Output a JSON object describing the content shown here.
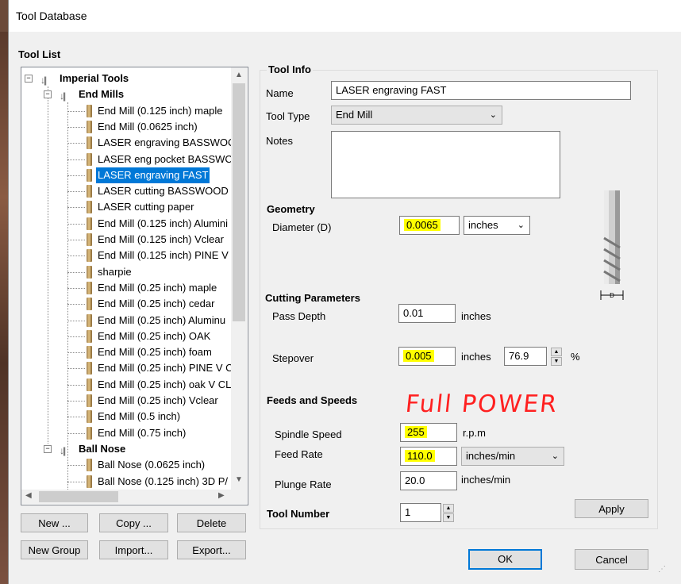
{
  "window": {
    "title": "Tool Database"
  },
  "tool_list": {
    "heading": "Tool List",
    "root": "Imperial Tools",
    "groups": [
      {
        "name": "End Mills",
        "items": [
          "End Mill (0.125 inch) maple",
          "End Mill (0.0625 inch)",
          "LASER engraving BASSWOC",
          "LASER eng pocket BASSWC",
          "LASER engraving FAST",
          "LASER cutting BASSWOOD",
          "LASER cutting paper",
          "End Mill (0.125 inch) Alumini",
          "End Mill (0.125 inch) Vclear",
          "End Mill (0.125 inch) PINE V",
          "sharpie",
          "End Mill (0.25 inch) maple",
          "End Mill (0.25 inch) cedar",
          "End Mill (0.25 inch) Aluminu",
          "End Mill (0.25 inch) OAK",
          "End Mill (0.25 inch) foam",
          "End Mill (0.25 inch) PINE V C",
          "End Mill (0.25 inch) oak V CL",
          "End Mill (0.25 inch) Vclear",
          "End Mill (0.5 inch)",
          "End Mill (0.75 inch)"
        ]
      },
      {
        "name": "Ball Nose",
        "items": [
          "Ball Nose (0.0625 inch)",
          "Ball Nose (0.125 inch) 3D P/"
        ]
      }
    ],
    "selected": "LASER engraving FAST",
    "buttons": {
      "new": "New ...",
      "copy": "Copy ...",
      "delete": "Delete",
      "new_group": "New Group",
      "import": "Import...",
      "export": "Export..."
    }
  },
  "tool_info": {
    "heading": "Tool Info",
    "name_label": "Name",
    "name_value": "LASER engraving FAST",
    "type_label": "Tool Type",
    "type_value": "End Mill",
    "notes_label": "Notes",
    "notes_value": ""
  },
  "geometry": {
    "heading": "Geometry",
    "diameter_label": "Diameter (D)",
    "diameter_value": "0.0065",
    "diameter_unit": "inches",
    "diagram_label": "D"
  },
  "cutting": {
    "heading": "Cutting Parameters",
    "pass_depth_label": "Pass Depth",
    "pass_depth_value": "0.01",
    "pass_depth_unit": "inches",
    "stepover_label": "Stepover",
    "stepover_value": "0.005",
    "stepover_unit": "inches",
    "stepover_percent": "76.9",
    "percent_sign": "%"
  },
  "feeds": {
    "heading": "Feeds and Speeds",
    "annotation": "Full POWER",
    "spindle_label": "Spindle Speed",
    "spindle_value": "255",
    "spindle_unit": "r.p.m",
    "feed_label": "Feed Rate",
    "feed_value": "110.0",
    "feed_unit": "inches/min",
    "plunge_label": "Plunge Rate",
    "plunge_value": "20.0",
    "plunge_unit": "inches/min"
  },
  "tool_number": {
    "label": "Tool Number",
    "value": "1"
  },
  "actions": {
    "apply": "Apply",
    "ok": "OK",
    "cancel": "Cancel"
  },
  "colors": {
    "highlight": "#ffff00",
    "selection": "#0078d7",
    "annotation": "#ff2020"
  }
}
